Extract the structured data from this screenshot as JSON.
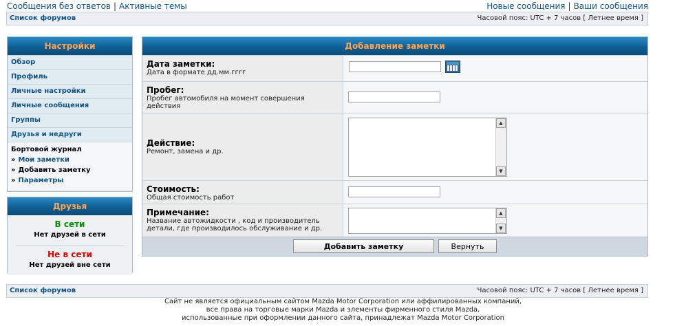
{
  "top_links": {
    "left": [
      "Сообщения без ответов",
      "Активные темы"
    ],
    "right": [
      "Новые сообщения",
      "Ваши сообщения"
    ],
    "separator": "|"
  },
  "navbar": {
    "crumb": "Список форумов",
    "timezone": "Часовой пояс: UTC + 7 часов [ Летнее время ]"
  },
  "settings_panel": {
    "title": "Настройки",
    "items": [
      "Обзор",
      "Профиль",
      "Личные настройки",
      "Личные сообщения",
      "Группы",
      "Друзья и недруги"
    ],
    "journal": {
      "title": "Бортовой журнал",
      "arrow": "»",
      "subitems": [
        "Мои заметки",
        "Добавить заметку",
        "Параметры"
      ]
    }
  },
  "friends_panel": {
    "title": "Друзья",
    "online_label": "В сети",
    "online_note": "Нет друзей в сети",
    "offline_label": "Не в сети",
    "offline_note": "Нет друзей вне сети"
  },
  "form": {
    "title": "Добавление заметки",
    "fields": [
      {
        "label": "Дата заметки:",
        "desc": "Дата в формате дд.мм.гггг",
        "value": ""
      },
      {
        "label": "Пробег:",
        "desc": "Пробег автомобиля на момент совершения действия",
        "value": ""
      },
      {
        "label": "Действие:",
        "desc": "Ремонт, замена и др.",
        "value": ""
      },
      {
        "label": "Стоимость:",
        "desc": "Общая стоимость работ",
        "value": ""
      },
      {
        "label": "Примечание:",
        "desc": "Название автожидкости , код и производитель детали, где производилось обслуживание и др.",
        "value": ""
      }
    ],
    "submit_label": "Добавить заметку",
    "reset_label": "Вернуть"
  },
  "icons": {
    "calendar": "calendar-icon",
    "scroll_up": "▲",
    "scroll_down": "▼"
  },
  "colors": {
    "header_bg": "#105c93",
    "header_text": "#ffa34f",
    "link": "#105289",
    "online": "#0c8b12",
    "offline": "#e00000"
  },
  "footer": {
    "lines": [
      "Сайт не является официальным сайтом Mazda Motor Corporation или аффилированных компаний,",
      "все права на торговые марки Mazda и элементы фирменного стиля Mazda,",
      "использованные при оформлении данного сайта, принадлежат Mazda Motor Corporation"
    ]
  }
}
